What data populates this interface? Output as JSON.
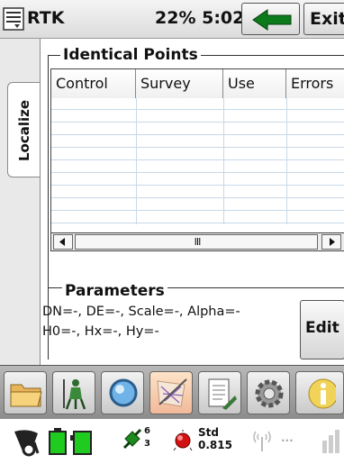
{
  "titlebar": {
    "app_mode": "RTK",
    "status": "22%  5:02",
    "exit_label": "Exit"
  },
  "side_tabs": [
    {
      "label": "Localize"
    }
  ],
  "identical_points": {
    "group_title": "Identical Points",
    "columns": [
      "Control",
      "Survey",
      "Use",
      "Errors"
    ],
    "rows": []
  },
  "scrollbar": {
    "grip_glyph": "III"
  },
  "parameters": {
    "group_title": "Parameters",
    "line1": "DN=-, DE=-, Scale=-, Alpha=-",
    "line2": "H0=-, Hx=-, Hy=-",
    "edit_label": "Edit"
  },
  "toolbar": {
    "tools": [
      {
        "icon": "folder-icon"
      },
      {
        "icon": "surveyor-icon"
      },
      {
        "icon": "magnifier-icon"
      },
      {
        "icon": "map-tools-icon",
        "active": true
      },
      {
        "icon": "notebook-icon"
      },
      {
        "icon": "gear-icon"
      },
      {
        "icon": "info-icon"
      }
    ]
  },
  "statusbar": {
    "satellites_glyph": "̶",
    "sats_sub": "6",
    "sats_sup": "3",
    "std_label": "Std",
    "std_value": "0.815",
    "dots": "..."
  },
  "colors": {
    "back_arrow": "#0c7a1b",
    "battery_green": "#1ecb1e",
    "toolbar_bg": "#a0a0a0"
  }
}
